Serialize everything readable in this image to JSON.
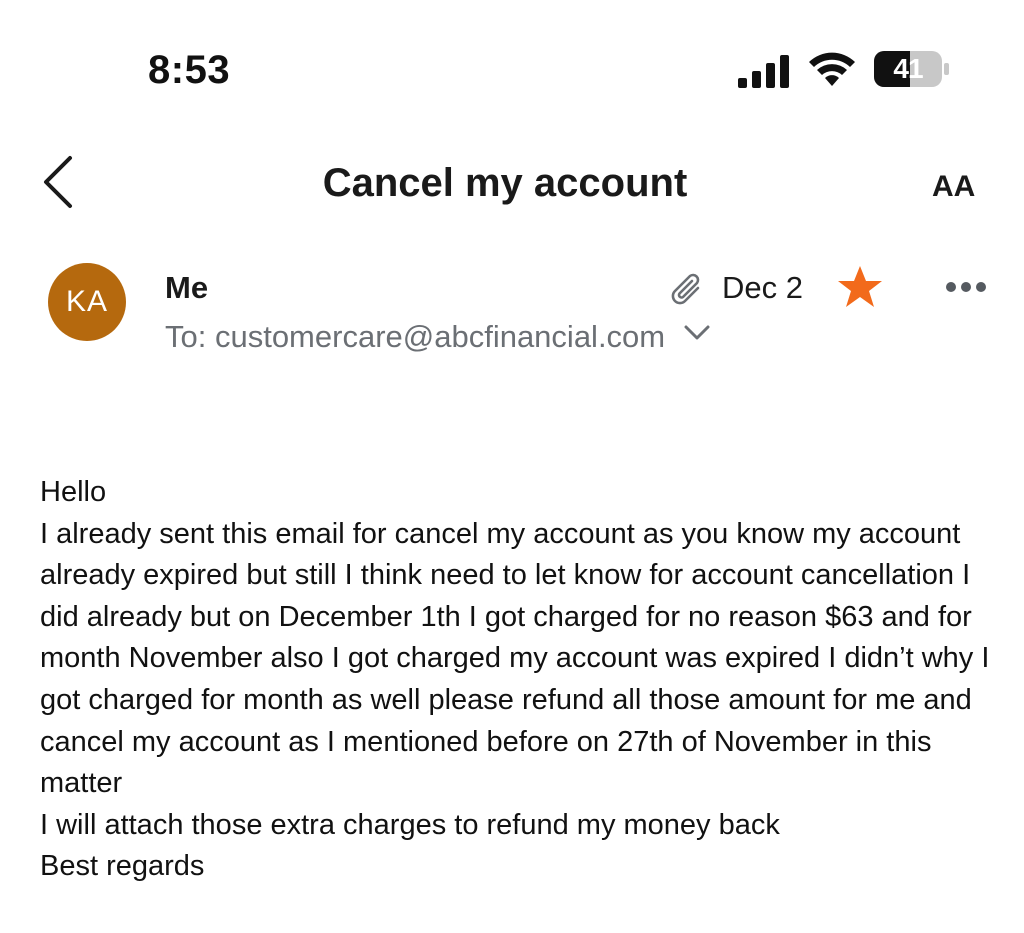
{
  "status_bar": {
    "time": "8:53",
    "battery_level": "41",
    "icons": [
      "signal-icon",
      "wifi-icon",
      "battery-icon"
    ]
  },
  "nav": {
    "title": "Cancel my account",
    "back_icon": "chevron-left-icon",
    "text_size_label": "AA"
  },
  "header": {
    "avatar_initials": "KA",
    "avatar_color": "#b5690e",
    "sender": "Me",
    "recipient": "To: customercare@abcfinancial.com",
    "date": "Dec 2",
    "starred": true,
    "star_color": "#f26a1b",
    "icons": [
      "paperclip-icon",
      "star-icon",
      "more-icon",
      "chevron-down-icon"
    ]
  },
  "body": {
    "greeting": "Hello",
    "paragraph": "I already sent this email for cancel my account as you know my account already expired but still I think need to let know for account cancellation I did already but on December 1th I got charged for no reason $63 and for month November also I got charged my account was expired I didn’t why I got charged for month as well please refund all those amount for me and cancel my account as I mentioned before on 27th of November in this matter",
    "closing_line": "I will attach those extra charges to refund my money back",
    "sign_off": "Best regards"
  }
}
